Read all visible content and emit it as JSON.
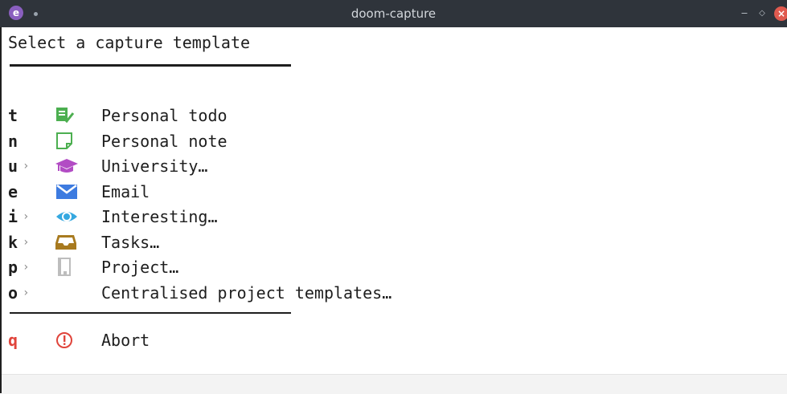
{
  "window": {
    "title": "doom-capture"
  },
  "heading": "Select a capture template",
  "items": [
    {
      "key": "t",
      "submenu": false,
      "icon": "todo-check-icon",
      "label": "Personal todo"
    },
    {
      "key": "n",
      "submenu": false,
      "icon": "note-icon",
      "label": "Personal note"
    },
    {
      "key": "u",
      "submenu": true,
      "icon": "graduation-cap-icon",
      "label": "University…"
    },
    {
      "key": "e",
      "submenu": false,
      "icon": "envelope-icon",
      "label": "Email"
    },
    {
      "key": "i",
      "submenu": true,
      "icon": "eye-icon",
      "label": "Interesting…"
    },
    {
      "key": "k",
      "submenu": true,
      "icon": "inbox-tray-icon",
      "label": "Tasks…"
    },
    {
      "key": "p",
      "submenu": true,
      "icon": "book-icon",
      "label": "Project…"
    },
    {
      "key": "o",
      "submenu": true,
      "icon": "",
      "label": "Centralised project templates…"
    }
  ],
  "abort": {
    "key": "q",
    "icon": "exclamation-circle-icon",
    "label": "Abort"
  },
  "submenu_marker": "›",
  "colors": {
    "todo": "#4caf50",
    "note": "#4caf50",
    "university": "#b24cc4",
    "email": "#3d7be0",
    "interesting": "#35a8e0",
    "tasks": "#a87a1f",
    "project": "#bdbdbd",
    "abort": "#e0443b"
  }
}
